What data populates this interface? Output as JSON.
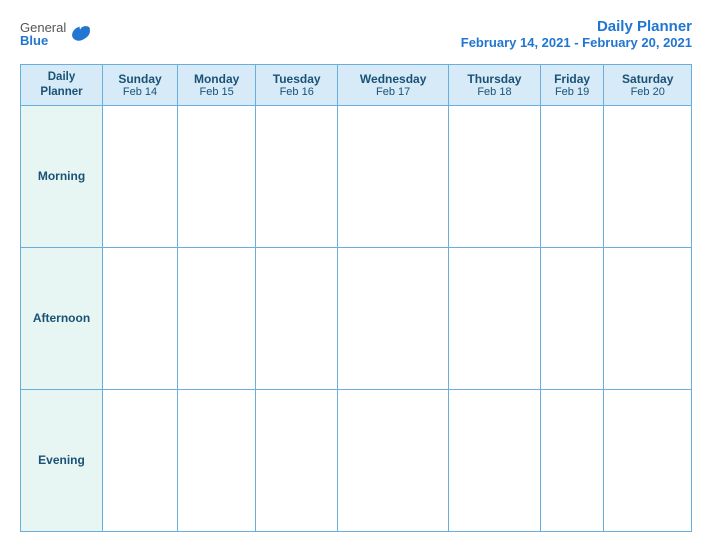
{
  "logo": {
    "general": "General",
    "blue": "Blue"
  },
  "header": {
    "title": "Daily Planner",
    "date_range": "February 14, 2021 - February 20, 2021"
  },
  "table": {
    "label_header": "Daily\nPlanner",
    "days": [
      {
        "name": "Sunday",
        "date": "Feb 14"
      },
      {
        "name": "Monday",
        "date": "Feb 15"
      },
      {
        "name": "Tuesday",
        "date": "Feb 16"
      },
      {
        "name": "Wednesday",
        "date": "Feb 17"
      },
      {
        "name": "Thursday",
        "date": "Feb 18"
      },
      {
        "name": "Friday",
        "date": "Feb 19"
      },
      {
        "name": "Saturday",
        "date": "Feb 20"
      }
    ],
    "rows": [
      {
        "label": "Morning"
      },
      {
        "label": "Afternoon"
      },
      {
        "label": "Evening"
      }
    ]
  }
}
